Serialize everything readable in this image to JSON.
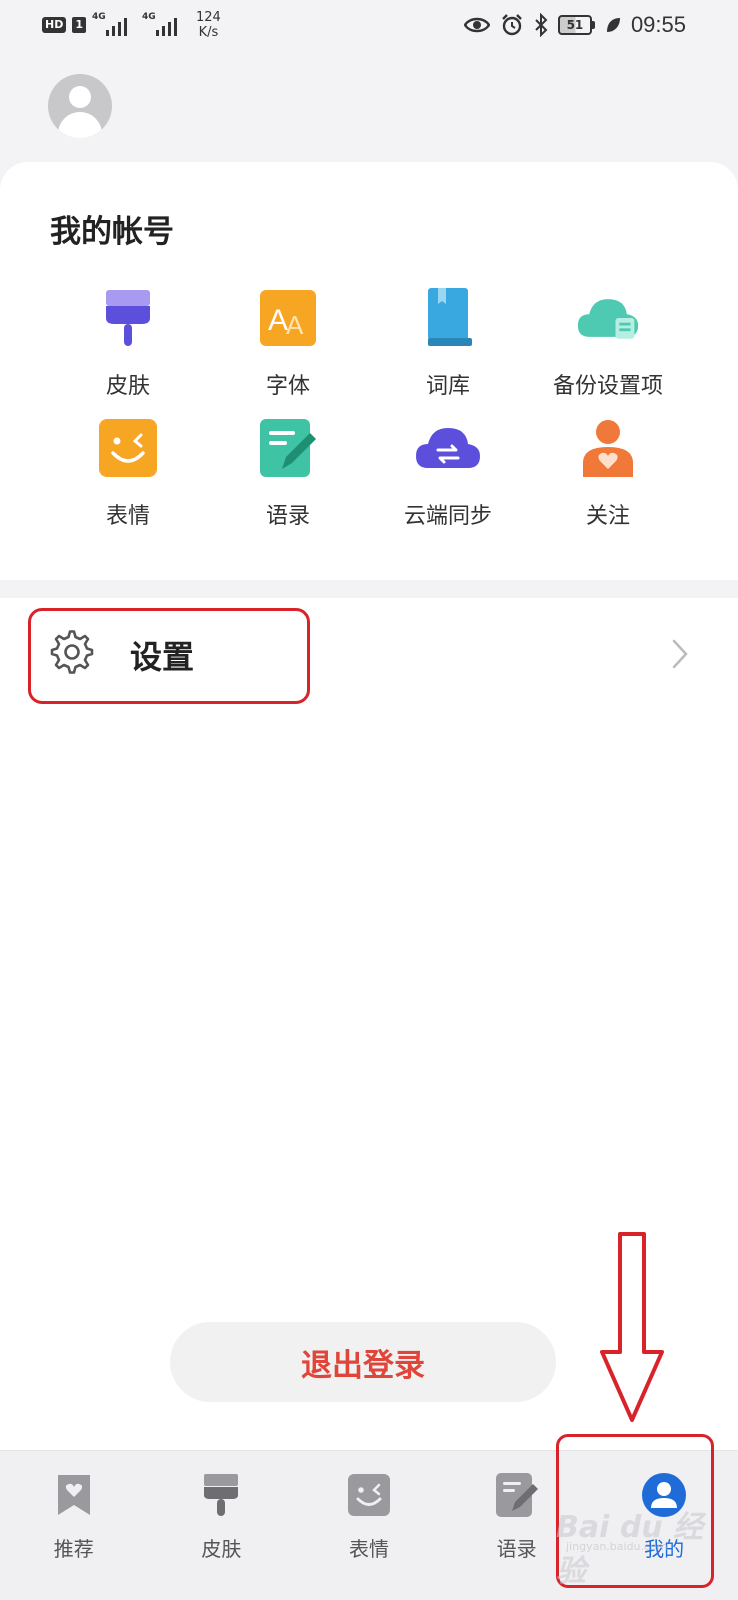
{
  "status_bar": {
    "hd": "HD",
    "sim": "1",
    "net1": "4G",
    "net2": "4G",
    "speed_value": "124",
    "speed_unit": "K/s",
    "battery": "51",
    "time": "09:55"
  },
  "account": {
    "title": "我的帐号",
    "items": [
      {
        "label": "皮肤",
        "icon": "paint-brush-icon"
      },
      {
        "label": "字体",
        "icon": "font-icon"
      },
      {
        "label": "词库",
        "icon": "book-icon"
      },
      {
        "label": "备份设置项",
        "icon": "cloud-backup-icon"
      },
      {
        "label": "表情",
        "icon": "wink-face-icon"
      },
      {
        "label": "语录",
        "icon": "note-pen-icon"
      },
      {
        "label": "云端同步",
        "icon": "cloud-sync-icon"
      },
      {
        "label": "关注",
        "icon": "person-heart-icon"
      }
    ]
  },
  "settings": {
    "label": "设置"
  },
  "logout": {
    "label": "退出登录"
  },
  "tabs": [
    {
      "label": "推荐",
      "icon": "bookmark-heart-icon"
    },
    {
      "label": "皮肤",
      "icon": "paint-brush-icon"
    },
    {
      "label": "表情",
      "icon": "wink-face-icon"
    },
    {
      "label": "语录",
      "icon": "note-pen-icon"
    },
    {
      "label": "我的",
      "icon": "user-icon",
      "active": true
    }
  ],
  "colors": {
    "accent_blue": "#1f6bd8",
    "logout_red": "#e0453a",
    "annotation_red": "#d8232a"
  },
  "watermark": {
    "text": "Bai du 经验",
    "sub": "jingyan.baidu.com"
  }
}
